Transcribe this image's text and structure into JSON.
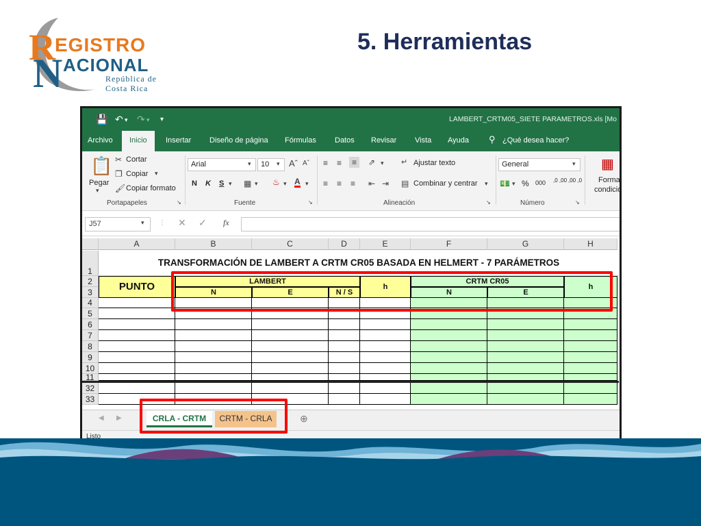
{
  "slide": {
    "title": "5. Herramientas"
  },
  "logo": {
    "r": "R",
    "r_rest": "EGISTRO",
    "n": "N",
    "n_rest": "ACIONAL",
    "sub1": "República de",
    "sub2": "Costa Rica"
  },
  "excel": {
    "doc_title": "LAMBERT_CRTM05_SIETE PARAMETROS.xls  [Mo",
    "tabs": [
      "Archivo",
      "Inicio",
      "Insertar",
      "Diseño de página",
      "Fórmulas",
      "Datos",
      "Revisar",
      "Vista",
      "Ayuda"
    ],
    "tell_me": "¿Qué desea hacer?",
    "clipboard": {
      "paste": "Pegar",
      "cut": "Cortar",
      "copy": "Copiar",
      "format_painter": "Copiar formato",
      "group": "Portapapeles"
    },
    "font": {
      "name": "Arial",
      "size": "10",
      "bold": "N",
      "italic": "K",
      "underline": "S",
      "group": "Fuente"
    },
    "alignment": {
      "wrap": "Ajustar texto",
      "merge": "Combinar y centrar",
      "group": "Alineación"
    },
    "number": {
      "format": "General",
      "percent": "%",
      "thousands": "000",
      "dec_inc": ",0 ,00",
      "dec_dec": ",00 ,0",
      "group": "Número"
    },
    "styles": {
      "label1": "Format",
      "label2": "condicion"
    },
    "name_box": "J57",
    "columns": [
      "A",
      "B",
      "C",
      "D",
      "E",
      "F",
      "G",
      "H"
    ],
    "rows": [
      "1",
      "2",
      "3",
      "4",
      "5",
      "6",
      "7",
      "8",
      "9",
      "10",
      "11",
      "32",
      "33"
    ],
    "sheet_title": "TRANSFORMACIÓN DE LAMBERT A CRTM CR05 BASADA EN HELMERT - 7 PARÁMETROS",
    "headers": {
      "punto": "PUNTO",
      "lambert": "LAMBERT",
      "n": "N",
      "e": "E",
      "ns": "N / S",
      "h": "h",
      "crtm": "CRTM CR05"
    },
    "sheet_tabs": [
      "CRLA - CRTM",
      "CRTM - CRLA"
    ],
    "status": "Listo"
  },
  "colors": {
    "excel_green": "#217346",
    "yellow": "#ffff99",
    "light_green": "#ccffcc",
    "highlight": "#ff0000",
    "title_navy": "#1f2d5a"
  }
}
